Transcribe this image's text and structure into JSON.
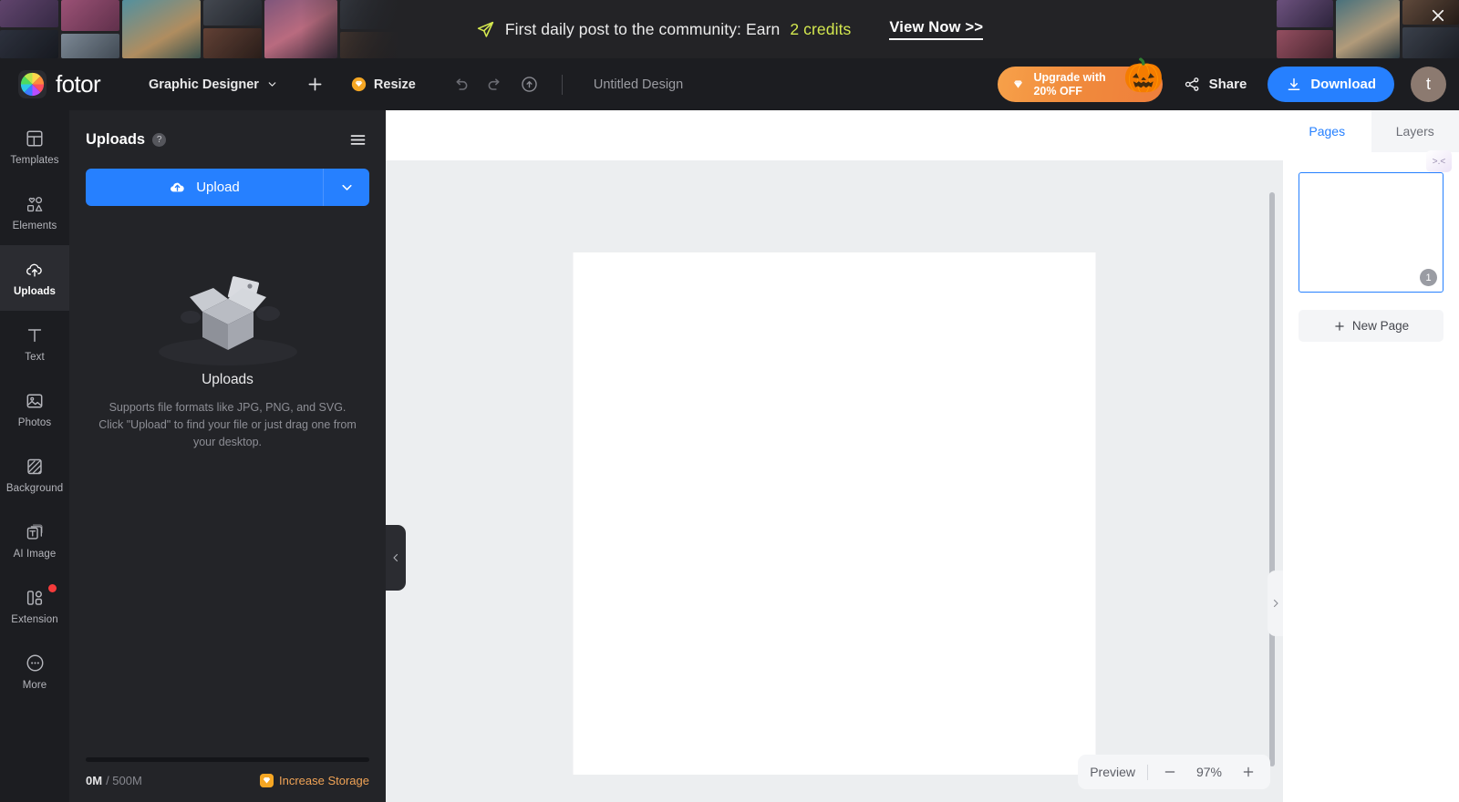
{
  "promo": {
    "message_prefix": "First daily post to the community: Earn ",
    "message_highlight": "2 credits",
    "cta": "View Now >>",
    "icon": "paper-plane-icon",
    "close_icon": "close-icon",
    "highlight_color": "#d4e84f",
    "background": "#232326"
  },
  "toolbar": {
    "logo_text": "fotor",
    "mode_label": "Graphic Designer",
    "add_icon": "plus-icon",
    "resize_label": "Resize",
    "undo_icon": "undo-icon",
    "redo_icon": "redo-icon",
    "cloud_icon": "cloud-upload-icon",
    "doc_title": "Untitled Design",
    "upgrade_line1": "Upgrade with",
    "upgrade_line2": "20% OFF",
    "upgrade_emoji": "🎃",
    "share_label": "Share",
    "download_label": "Download",
    "avatar_initial": "t",
    "accent_blue": "#2680ff",
    "upgrade_orange": "#f08a3c"
  },
  "sidebar": {
    "items": [
      {
        "label": "Templates",
        "icon": "templates-icon",
        "active": false,
        "badge": false
      },
      {
        "label": "Elements",
        "icon": "elements-icon",
        "active": false,
        "badge": false
      },
      {
        "label": "Uploads",
        "icon": "uploads-cloud-icon",
        "active": true,
        "badge": false
      },
      {
        "label": "Text",
        "icon": "text-icon",
        "active": false,
        "badge": false
      },
      {
        "label": "Photos",
        "icon": "photos-icon",
        "active": false,
        "badge": false
      },
      {
        "label": "Background",
        "icon": "background-icon",
        "active": false,
        "badge": false
      },
      {
        "label": "AI Image",
        "icon": "ai-image-icon",
        "active": false,
        "badge": false
      },
      {
        "label": "Extension",
        "icon": "extension-icon",
        "active": false,
        "badge": true
      },
      {
        "label": "More",
        "icon": "more-dots-icon",
        "active": false,
        "badge": false
      }
    ]
  },
  "uploads_panel": {
    "title": "Uploads",
    "help_icon": "question-mark-icon",
    "menu_icon": "hamburger-menu-icon",
    "upload_button": "Upload",
    "upload_icon": "cloud-icon",
    "caret_icon": "chevron-down-icon",
    "empty_title": "Uploads",
    "empty_description": "Supports file formats like JPG, PNG, and SVG. Click \"Upload\" to find your file or just drag one from your desktop.",
    "empty_illustration": "open-box-icon",
    "storage_used": "0M",
    "storage_total": "/ 500M",
    "storage_cta": "Increase Storage",
    "storage_cta_icon": "diamond-icon",
    "storage_percent": 0
  },
  "canvas": {
    "collapse_left_icon": "chevron-left-icon",
    "collapse_right_icon": "chevron-right-icon",
    "preview_label": "Preview",
    "zoom_out_icon": "minus-icon",
    "zoom_level": "97%",
    "zoom_in_icon": "plus-icon"
  },
  "pages_panel": {
    "tabs": [
      {
        "label": "Pages",
        "active": true
      },
      {
        "label": "Layers",
        "active": false
      }
    ],
    "collapse_icon": "collapse-panel-icon",
    "pages": [
      {
        "number": "1"
      }
    ],
    "new_page_label": "New Page",
    "new_page_icon": "plus-icon"
  }
}
